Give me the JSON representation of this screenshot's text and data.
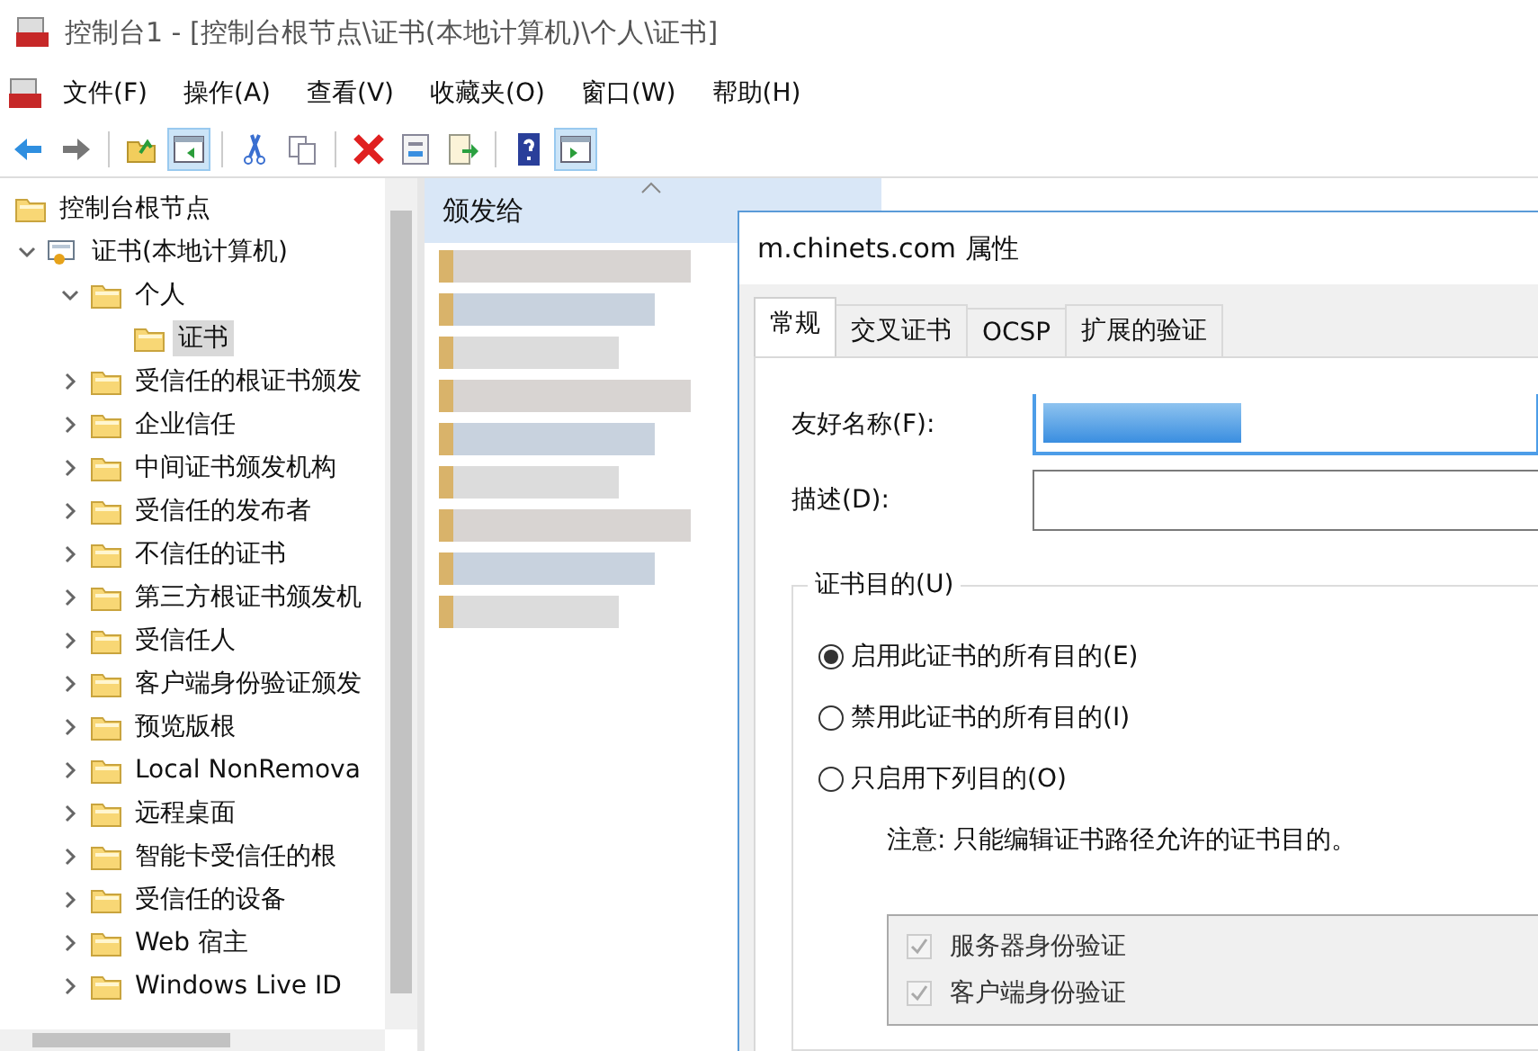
{
  "window": {
    "title": "控制台1 - [控制台根节点\\证书(本地计算机)\\个人\\证书]"
  },
  "menu": [
    "文件(F)",
    "操作(A)",
    "查看(V)",
    "收藏夹(O)",
    "窗口(W)",
    "帮助(H)"
  ],
  "toolbar": [
    {
      "kind": "back",
      "pressed": false
    },
    {
      "kind": "forward",
      "pressed": false
    },
    {
      "kind": "sep"
    },
    {
      "kind": "up",
      "pressed": false
    },
    {
      "kind": "tree",
      "pressed": true
    },
    {
      "kind": "sep"
    },
    {
      "kind": "cut",
      "pressed": false
    },
    {
      "kind": "copy",
      "pressed": false
    },
    {
      "kind": "sep"
    },
    {
      "kind": "delete",
      "pressed": false
    },
    {
      "kind": "properties",
      "pressed": false
    },
    {
      "kind": "export",
      "pressed": false
    },
    {
      "kind": "sep"
    },
    {
      "kind": "help",
      "pressed": false
    },
    {
      "kind": "pane",
      "pressed": true
    }
  ],
  "tree": [
    {
      "label": "控制台根节点",
      "kind": "folder",
      "selected": false,
      "children": [
        {
          "label": "证书(本地计算机)",
          "kind": "store",
          "expanded": true,
          "selected": false,
          "children": [
            {
              "label": "个人",
              "kind": "folder",
              "expanded": true,
              "selected": false,
              "children": [
                {
                  "label": "证书",
                  "kind": "folder",
                  "selected": true
                }
              ]
            },
            {
              "label": "受信任的根证书颁发",
              "kind": "folder",
              "expanded": false,
              "selected": false
            },
            {
              "label": "企业信任",
              "kind": "folder",
              "expanded": false,
              "selected": false
            },
            {
              "label": "中间证书颁发机构",
              "kind": "folder",
              "expanded": false,
              "selected": false
            },
            {
              "label": "受信任的发布者",
              "kind": "folder",
              "expanded": false,
              "selected": false
            },
            {
              "label": "不信任的证书",
              "kind": "folder",
              "expanded": false,
              "selected": false
            },
            {
              "label": "第三方根证书颁发机",
              "kind": "folder",
              "expanded": false,
              "selected": false
            },
            {
              "label": "受信任人",
              "kind": "folder",
              "expanded": false,
              "selected": false
            },
            {
              "label": "客户端身份验证颁发",
              "kind": "folder",
              "expanded": false,
              "selected": false
            },
            {
              "label": "预览版根",
              "kind": "folder",
              "expanded": false,
              "selected": false
            },
            {
              "label": "Local NonRemova",
              "kind": "folder",
              "expanded": false,
              "selected": false
            },
            {
              "label": "远程桌面",
              "kind": "folder",
              "expanded": false,
              "selected": false
            },
            {
              "label": "智能卡受信任的根",
              "kind": "folder",
              "expanded": false,
              "selected": false
            },
            {
              "label": "受信任的设备",
              "kind": "folder",
              "expanded": false,
              "selected": false
            },
            {
              "label": "Web 宿主",
              "kind": "folder",
              "expanded": false,
              "selected": false
            },
            {
              "label": "Windows Live ID",
              "kind": "folder",
              "expanded": false,
              "selected": false
            }
          ]
        }
      ]
    }
  ],
  "list": {
    "columns": [
      {
        "label": "颁发给",
        "sorted": true
      }
    ]
  },
  "dialog": {
    "title": "m.chinets.com 属性",
    "tabs": [
      {
        "label": "常规",
        "selected": true
      },
      {
        "label": "交叉证书",
        "selected": false
      },
      {
        "label": "OCSP",
        "selected": false
      },
      {
        "label": "扩展的验证",
        "selected": false
      }
    ],
    "fields": [
      {
        "label": "友好名称(F):",
        "focused": true
      },
      {
        "label": "描述(D):",
        "focused": false
      }
    ],
    "purpose_group": {
      "title": "证书目的(U)",
      "options": [
        {
          "label": "启用此证书的所有目的(E)",
          "selected": true
        },
        {
          "label": "禁用此证书的所有目的(I)",
          "selected": false
        },
        {
          "label": "只启用下列目的(O)",
          "selected": false
        }
      ],
      "note": "注意: 只能编辑证书路径允许的证书目的。",
      "purposes": [
        {
          "label": "服务器身份验证",
          "checked": true,
          "disabled": true
        },
        {
          "label": "客户端身份验证",
          "checked": true,
          "disabled": true
        }
      ]
    }
  }
}
